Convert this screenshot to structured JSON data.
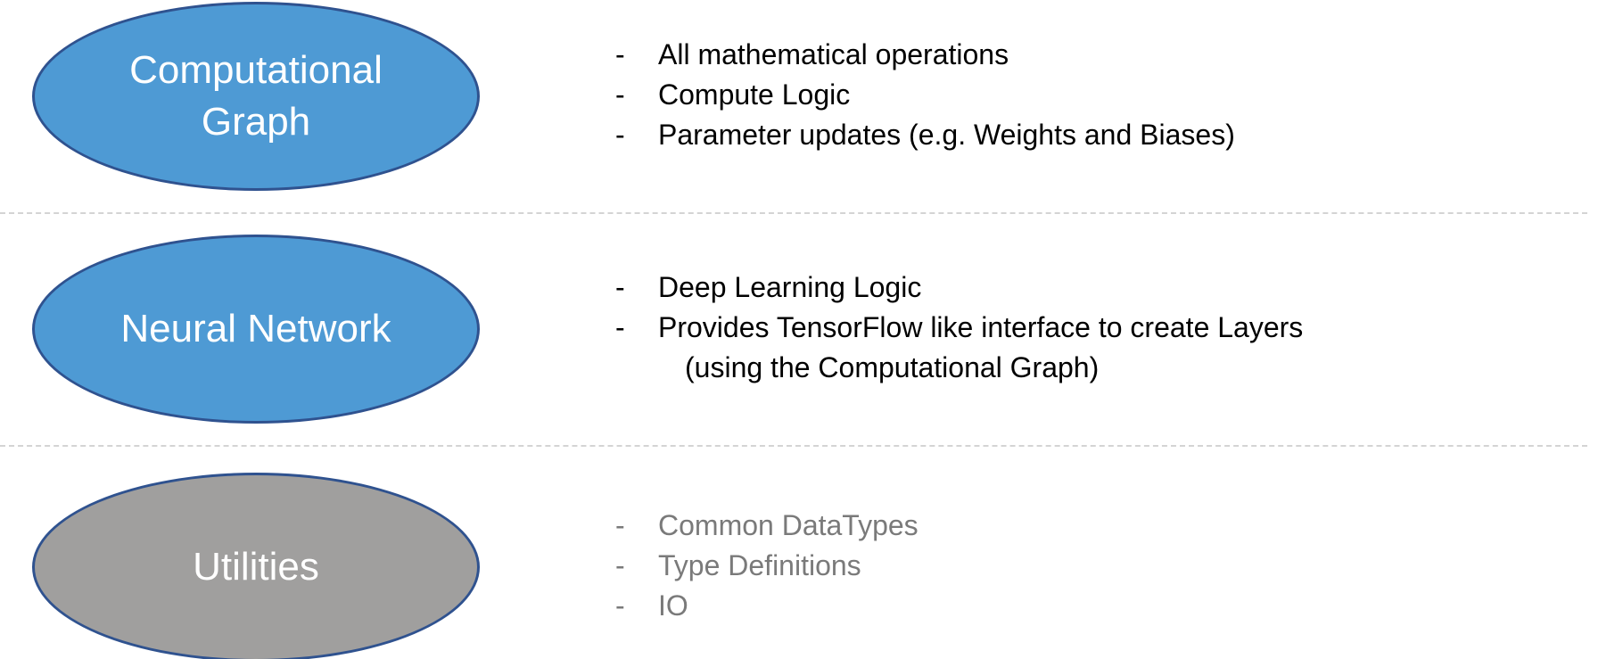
{
  "colors": {
    "ellipse_blue": "#4E9AD4",
    "ellipse_gray": "#A09F9E",
    "ellipse_border": "#2F528F",
    "text_dark": "#000000",
    "text_muted": "#7a7a7a"
  },
  "rows": [
    {
      "title_lines": [
        "Computational",
        "Graph"
      ],
      "bullets": [
        "All mathematical operations",
        "Compute Logic",
        "Parameter updates (e.g. Weights and Biases)"
      ]
    },
    {
      "title_lines": [
        "Neural Network"
      ],
      "bullets": [
        "Deep Learning Logic",
        "Provides TensorFlow like interface to create Layers"
      ],
      "continuation": "(using the Computational Graph)"
    },
    {
      "title_lines": [
        "Utilities"
      ],
      "bullets": [
        "Common DataTypes",
        "Type Definitions",
        "IO"
      ]
    }
  ],
  "dash": "-"
}
